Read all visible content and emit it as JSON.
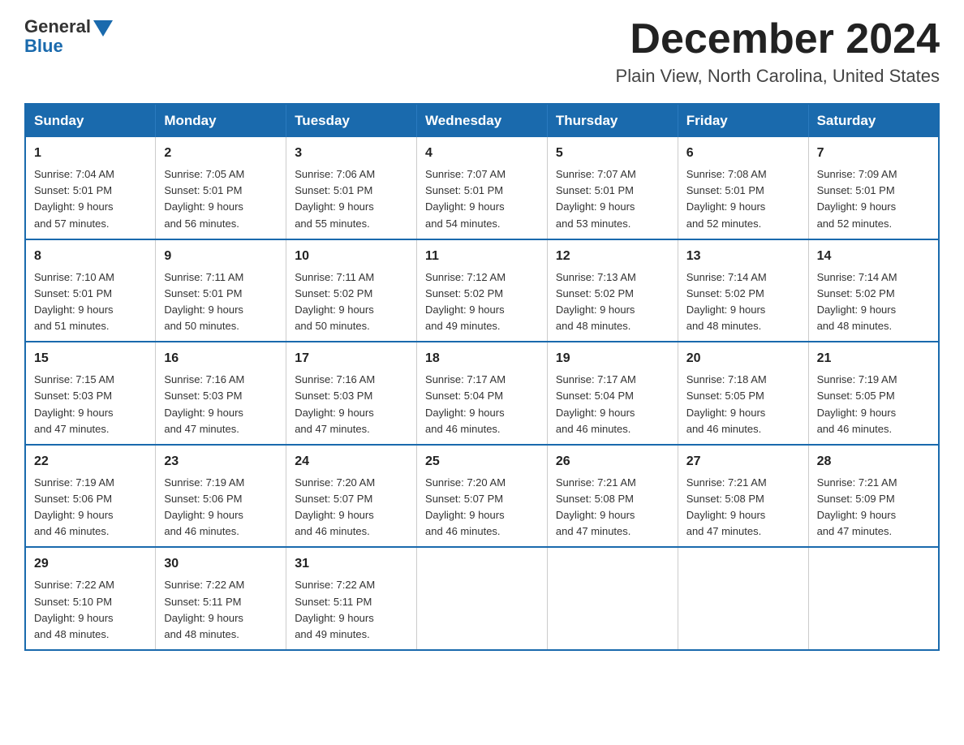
{
  "logo": {
    "general": "General",
    "blue": "Blue"
  },
  "header": {
    "month": "December 2024",
    "location": "Plain View, North Carolina, United States"
  },
  "weekdays": [
    "Sunday",
    "Monday",
    "Tuesday",
    "Wednesday",
    "Thursday",
    "Friday",
    "Saturday"
  ],
  "weeks": [
    [
      {
        "day": "1",
        "sunrise": "7:04 AM",
        "sunset": "5:01 PM",
        "daylight": "9 hours and 57 minutes."
      },
      {
        "day": "2",
        "sunrise": "7:05 AM",
        "sunset": "5:01 PM",
        "daylight": "9 hours and 56 minutes."
      },
      {
        "day": "3",
        "sunrise": "7:06 AM",
        "sunset": "5:01 PM",
        "daylight": "9 hours and 55 minutes."
      },
      {
        "day": "4",
        "sunrise": "7:07 AM",
        "sunset": "5:01 PM",
        "daylight": "9 hours and 54 minutes."
      },
      {
        "day": "5",
        "sunrise": "7:07 AM",
        "sunset": "5:01 PM",
        "daylight": "9 hours and 53 minutes."
      },
      {
        "day": "6",
        "sunrise": "7:08 AM",
        "sunset": "5:01 PM",
        "daylight": "9 hours and 52 minutes."
      },
      {
        "day": "7",
        "sunrise": "7:09 AM",
        "sunset": "5:01 PM",
        "daylight": "9 hours and 52 minutes."
      }
    ],
    [
      {
        "day": "8",
        "sunrise": "7:10 AM",
        "sunset": "5:01 PM",
        "daylight": "9 hours and 51 minutes."
      },
      {
        "day": "9",
        "sunrise": "7:11 AM",
        "sunset": "5:01 PM",
        "daylight": "9 hours and 50 minutes."
      },
      {
        "day": "10",
        "sunrise": "7:11 AM",
        "sunset": "5:02 PM",
        "daylight": "9 hours and 50 minutes."
      },
      {
        "day": "11",
        "sunrise": "7:12 AM",
        "sunset": "5:02 PM",
        "daylight": "9 hours and 49 minutes."
      },
      {
        "day": "12",
        "sunrise": "7:13 AM",
        "sunset": "5:02 PM",
        "daylight": "9 hours and 48 minutes."
      },
      {
        "day": "13",
        "sunrise": "7:14 AM",
        "sunset": "5:02 PM",
        "daylight": "9 hours and 48 minutes."
      },
      {
        "day": "14",
        "sunrise": "7:14 AM",
        "sunset": "5:02 PM",
        "daylight": "9 hours and 48 minutes."
      }
    ],
    [
      {
        "day": "15",
        "sunrise": "7:15 AM",
        "sunset": "5:03 PM",
        "daylight": "9 hours and 47 minutes."
      },
      {
        "day": "16",
        "sunrise": "7:16 AM",
        "sunset": "5:03 PM",
        "daylight": "9 hours and 47 minutes."
      },
      {
        "day": "17",
        "sunrise": "7:16 AM",
        "sunset": "5:03 PM",
        "daylight": "9 hours and 47 minutes."
      },
      {
        "day": "18",
        "sunrise": "7:17 AM",
        "sunset": "5:04 PM",
        "daylight": "9 hours and 46 minutes."
      },
      {
        "day": "19",
        "sunrise": "7:17 AM",
        "sunset": "5:04 PM",
        "daylight": "9 hours and 46 minutes."
      },
      {
        "day": "20",
        "sunrise": "7:18 AM",
        "sunset": "5:05 PM",
        "daylight": "9 hours and 46 minutes."
      },
      {
        "day": "21",
        "sunrise": "7:19 AM",
        "sunset": "5:05 PM",
        "daylight": "9 hours and 46 minutes."
      }
    ],
    [
      {
        "day": "22",
        "sunrise": "7:19 AM",
        "sunset": "5:06 PM",
        "daylight": "9 hours and 46 minutes."
      },
      {
        "day": "23",
        "sunrise": "7:19 AM",
        "sunset": "5:06 PM",
        "daylight": "9 hours and 46 minutes."
      },
      {
        "day": "24",
        "sunrise": "7:20 AM",
        "sunset": "5:07 PM",
        "daylight": "9 hours and 46 minutes."
      },
      {
        "day": "25",
        "sunrise": "7:20 AM",
        "sunset": "5:07 PM",
        "daylight": "9 hours and 46 minutes."
      },
      {
        "day": "26",
        "sunrise": "7:21 AM",
        "sunset": "5:08 PM",
        "daylight": "9 hours and 47 minutes."
      },
      {
        "day": "27",
        "sunrise": "7:21 AM",
        "sunset": "5:08 PM",
        "daylight": "9 hours and 47 minutes."
      },
      {
        "day": "28",
        "sunrise": "7:21 AM",
        "sunset": "5:09 PM",
        "daylight": "9 hours and 47 minutes."
      }
    ],
    [
      {
        "day": "29",
        "sunrise": "7:22 AM",
        "sunset": "5:10 PM",
        "daylight": "9 hours and 48 minutes."
      },
      {
        "day": "30",
        "sunrise": "7:22 AM",
        "sunset": "5:11 PM",
        "daylight": "9 hours and 48 minutes."
      },
      {
        "day": "31",
        "sunrise": "7:22 AM",
        "sunset": "5:11 PM",
        "daylight": "9 hours and 49 minutes."
      },
      null,
      null,
      null,
      null
    ]
  ],
  "labels": {
    "sunrise": "Sunrise:",
    "sunset": "Sunset:",
    "daylight": "Daylight:"
  }
}
